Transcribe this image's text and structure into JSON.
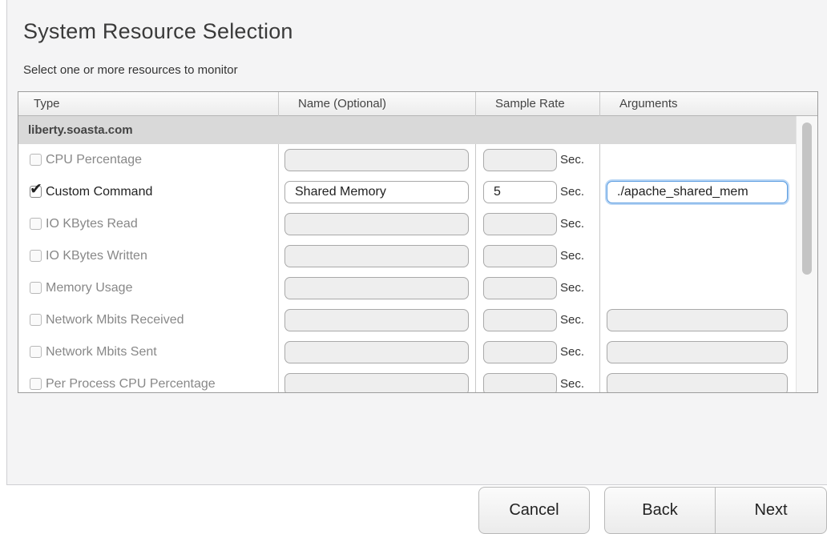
{
  "header": {
    "title": "System Resource Selection",
    "subtitle": "Select one or more resources to monitor"
  },
  "table": {
    "columns": [
      "Type",
      "Name (Optional)",
      "Sample Rate",
      "Arguments"
    ],
    "group": "liberty.soasta.com",
    "sec_label": "Sec.",
    "rows": [
      {
        "type": "CPU Percentage",
        "checked": false,
        "name": "",
        "rate": "",
        "args_field": false,
        "args": ""
      },
      {
        "type": "Custom Command",
        "checked": true,
        "name": "Shared Memory",
        "rate": "5",
        "args_field": true,
        "args": "./apache_shared_mem"
      },
      {
        "type": "IO KBytes Read",
        "checked": false,
        "name": "",
        "rate": "",
        "args_field": false,
        "args": ""
      },
      {
        "type": "IO KBytes Written",
        "checked": false,
        "name": "",
        "rate": "",
        "args_field": false,
        "args": ""
      },
      {
        "type": "Memory Usage",
        "checked": false,
        "name": "",
        "rate": "",
        "args_field": false,
        "args": ""
      },
      {
        "type": "Network Mbits Received",
        "checked": false,
        "name": "",
        "rate": "",
        "args_field": true,
        "args": ""
      },
      {
        "type": "Network Mbits Sent",
        "checked": false,
        "name": "",
        "rate": "",
        "args_field": true,
        "args": ""
      },
      {
        "type": "Per Process CPU Percentage",
        "checked": false,
        "name": "",
        "rate": "",
        "args_field": true,
        "args": ""
      },
      {
        "type": "",
        "checked": false,
        "name": "",
        "rate": "",
        "args_field": true,
        "args": ""
      }
    ]
  },
  "buttons": {
    "cancel": "Cancel",
    "back": "Back",
    "next": "Next"
  },
  "colors": {
    "focus": "#5a9ce0",
    "group_bg": "#d9d9d9",
    "panel_bg": "#f4f4f5"
  }
}
